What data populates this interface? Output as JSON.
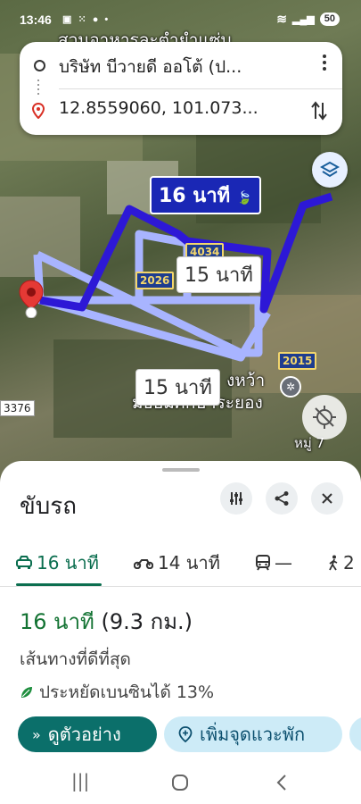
{
  "status_bar": {
    "time": "13:46",
    "battery": "50"
  },
  "map_top_label": "สวนอาหารละตำยำแซ่บ",
  "route_card": {
    "origin": "บริษัท บีวายดี ออโต้ (ป...",
    "destination": "12.8559060, 101.073..."
  },
  "map": {
    "primary_chip": "16 นาที",
    "alt_chip_1": "15 นาที",
    "alt_chip_2": "15 นาที",
    "road_4034": "4034",
    "road_2026": "2026",
    "road_2015": "2015",
    "road_3376": "3376",
    "place_line1": "งหว้า",
    "place_line2": "มัธยมศึกษาระยอง",
    "village_label": "หมู่ 7",
    "route_colors": {
      "primary": "#2d18d6",
      "alternate": "#a8b4ff"
    }
  },
  "sheet": {
    "title": "ขับรถ",
    "modes": [
      {
        "icon": "car-icon",
        "label": "16 นาที"
      },
      {
        "icon": "motorcycle-icon",
        "label": "14 นาที"
      },
      {
        "icon": "transit-icon",
        "label": "—"
      },
      {
        "icon": "walk-icon",
        "label": "2"
      }
    ],
    "duration": "16 นาที",
    "distance": "(9.3 กม.)",
    "route_desc": "เส้นทางที่ดีที่สุด",
    "eco": "ประหยัดเบนซินได้ 13%",
    "preview_label": "ดูตัวอย่าง",
    "add_stop_label": "เพิ่มจุดแวะพัก"
  }
}
